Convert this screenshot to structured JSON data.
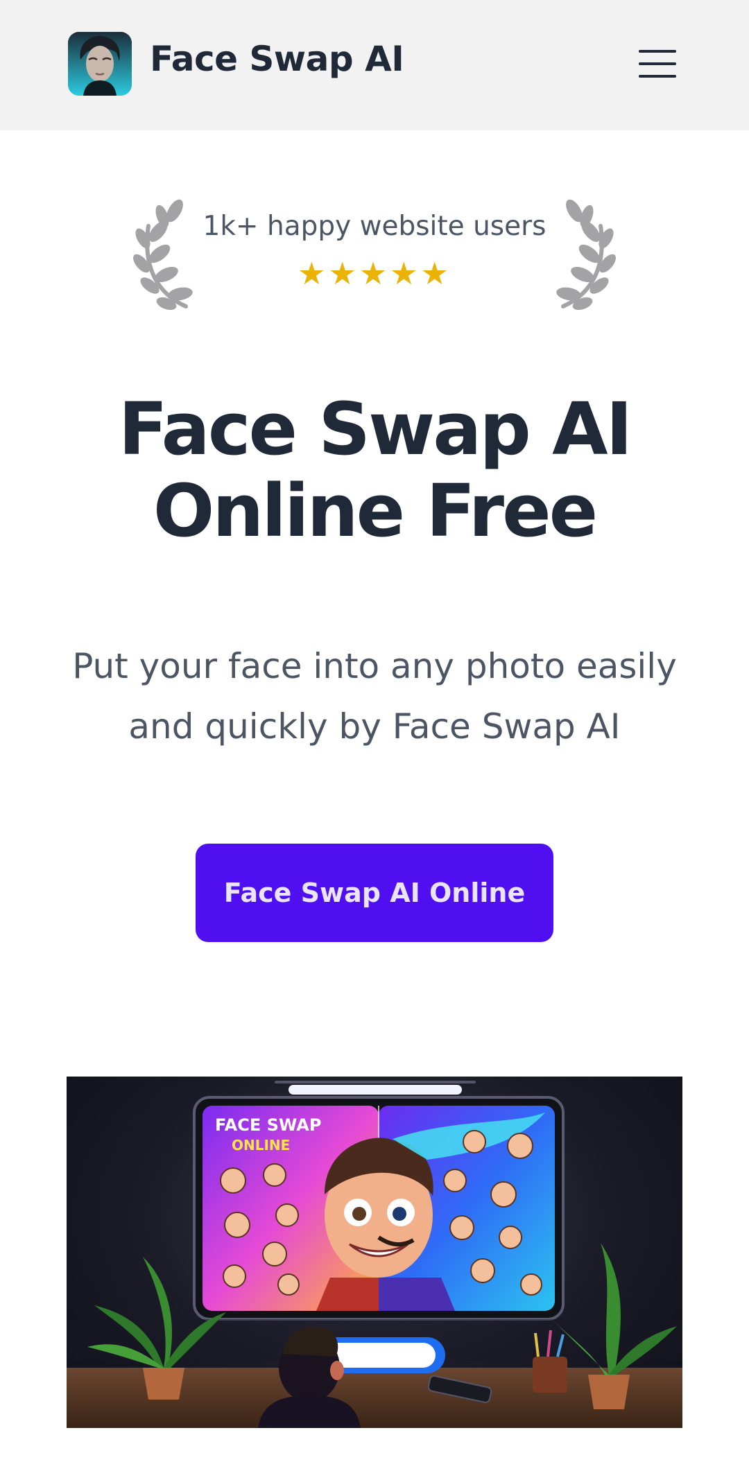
{
  "header": {
    "brand": "Face Swap AI",
    "logo_icon": "face-portrait-icon",
    "menu_icon": "hamburger-menu-icon"
  },
  "badge": {
    "text": "1k+ happy website users",
    "stars": "★★★★★",
    "rating": 5,
    "rating_max": 5
  },
  "hero": {
    "title_line1": "Face Swap AI",
    "title_line2": "Online Free",
    "subtitle": "Put your face into any photo easily and quickly by Face Swap AI",
    "cta_label": "Face Swap AI Online"
  },
  "illustration": {
    "screen_title_line1": "FACE SWAP",
    "screen_title_line2": "ONLINE"
  },
  "colors": {
    "header_bg": "#f2f2f3",
    "cta_bg": "#4f0ff0",
    "star": "#eab308",
    "heading": "#1f2937",
    "body_text": "#4b5563"
  }
}
